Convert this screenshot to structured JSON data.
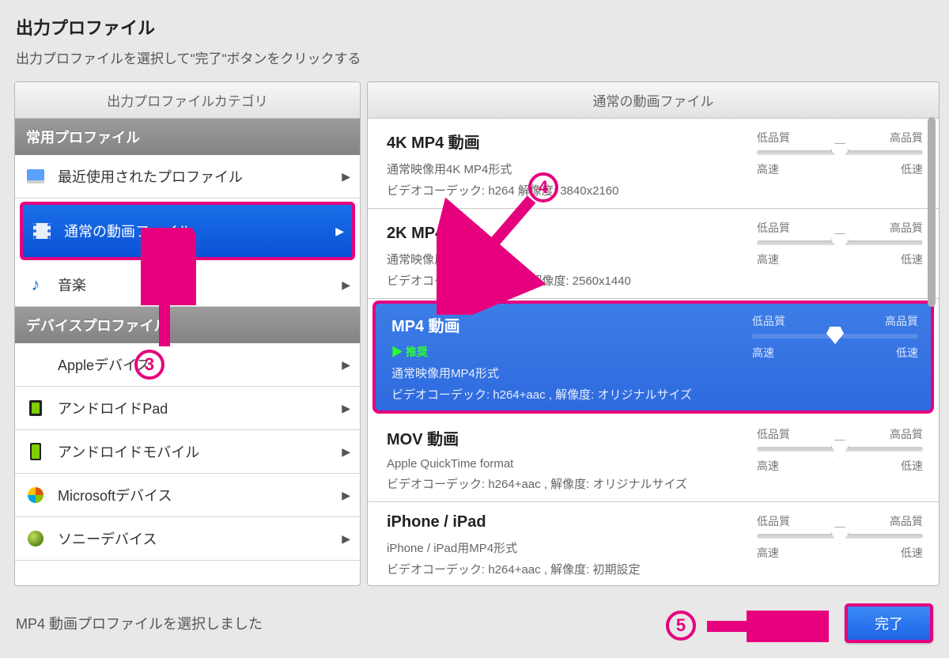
{
  "header": {
    "title": "出力プロファイル",
    "subtitle": "出力プロファイルを選択して\"完了\"ボタンをクリックする"
  },
  "left": {
    "column_header": "出力プロファイルカテゴリ",
    "sections": [
      {
        "title": "常用プロファイル",
        "items": [
          {
            "label": "最近使用されたプロファイル",
            "icon": "monitor"
          },
          {
            "label": "通常の動画ファイル",
            "icon": "film",
            "selected": true
          },
          {
            "label": "音楽",
            "icon": "note"
          }
        ]
      },
      {
        "title": "デバイスプロファイル",
        "items": [
          {
            "label": "Appleデバイス",
            "icon": "apple"
          },
          {
            "label": "アンドロイドPad",
            "icon": "android-pad"
          },
          {
            "label": "アンドロイドモバイル",
            "icon": "android-mobile"
          },
          {
            "label": "Microsoftデバイス",
            "icon": "windows"
          },
          {
            "label": "ソニーデバイス",
            "icon": "sony"
          }
        ]
      }
    ]
  },
  "right": {
    "column_header": "通常の動画ファイル",
    "quality_low": "低品質",
    "quality_high": "高品質",
    "speed_fast": "高速",
    "speed_slow": "低速",
    "items": [
      {
        "title": "4K MP4 動画",
        "desc": "通常映像用4K MP4形式",
        "codec": "ビデオコーデック: h264        解像度: 3840x2160"
      },
      {
        "title": "2K MP4 動画",
        "desc": "通常映像用       P4形式",
        "codec": "ビデオコー     ク: h264+aac , 解像度: 2560x1440"
      },
      {
        "title": "MP4 動画",
        "recommend": "▶ 推奨",
        "desc": "通常映像用MP4形式",
        "codec": "ビデオコーデック: h264+aac , 解像度: オリジナルサイズ",
        "selected": true
      },
      {
        "title": "MOV 動画",
        "desc": "Apple QuickTime format",
        "codec": "ビデオコーデック: h264+aac , 解像度: オリジナルサイズ"
      },
      {
        "title": "iPhone / iPad",
        "desc": "iPhone / iPad用MP4形式",
        "codec": "ビデオコーデック: h264+aac , 解像度: 初期設定"
      }
    ]
  },
  "footer": {
    "status": "MP4 動画プロファイルを選択しました",
    "done": "完了"
  },
  "annotations": {
    "n3": "3",
    "n4": "4",
    "n5": "5"
  }
}
